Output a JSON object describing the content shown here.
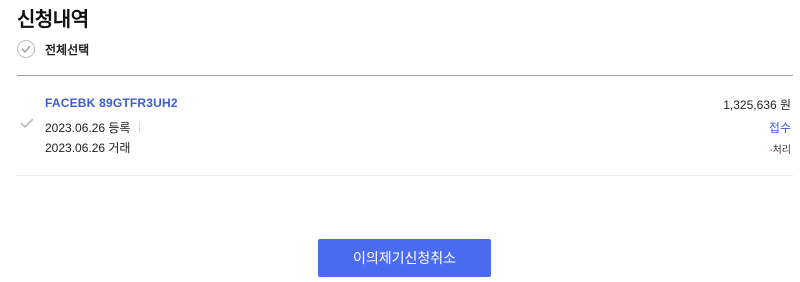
{
  "page": {
    "title": "신청내역"
  },
  "select_all": {
    "label": "전체선택"
  },
  "items": [
    {
      "code": "FACEBK 89GTFR3UH2",
      "registered": "2023.06.26 등록",
      "traded": "2023.06.26 거래",
      "amount": "1,325,636 원",
      "status": "접수",
      "sub_prefix": "-",
      "sub_status": "처리"
    }
  ],
  "actions": {
    "cancel_label": "이의제기신청취소"
  },
  "colors": {
    "accent": "#3c5bd8",
    "button": "#4b6cf0",
    "sub_marker": "#e25b3a"
  }
}
